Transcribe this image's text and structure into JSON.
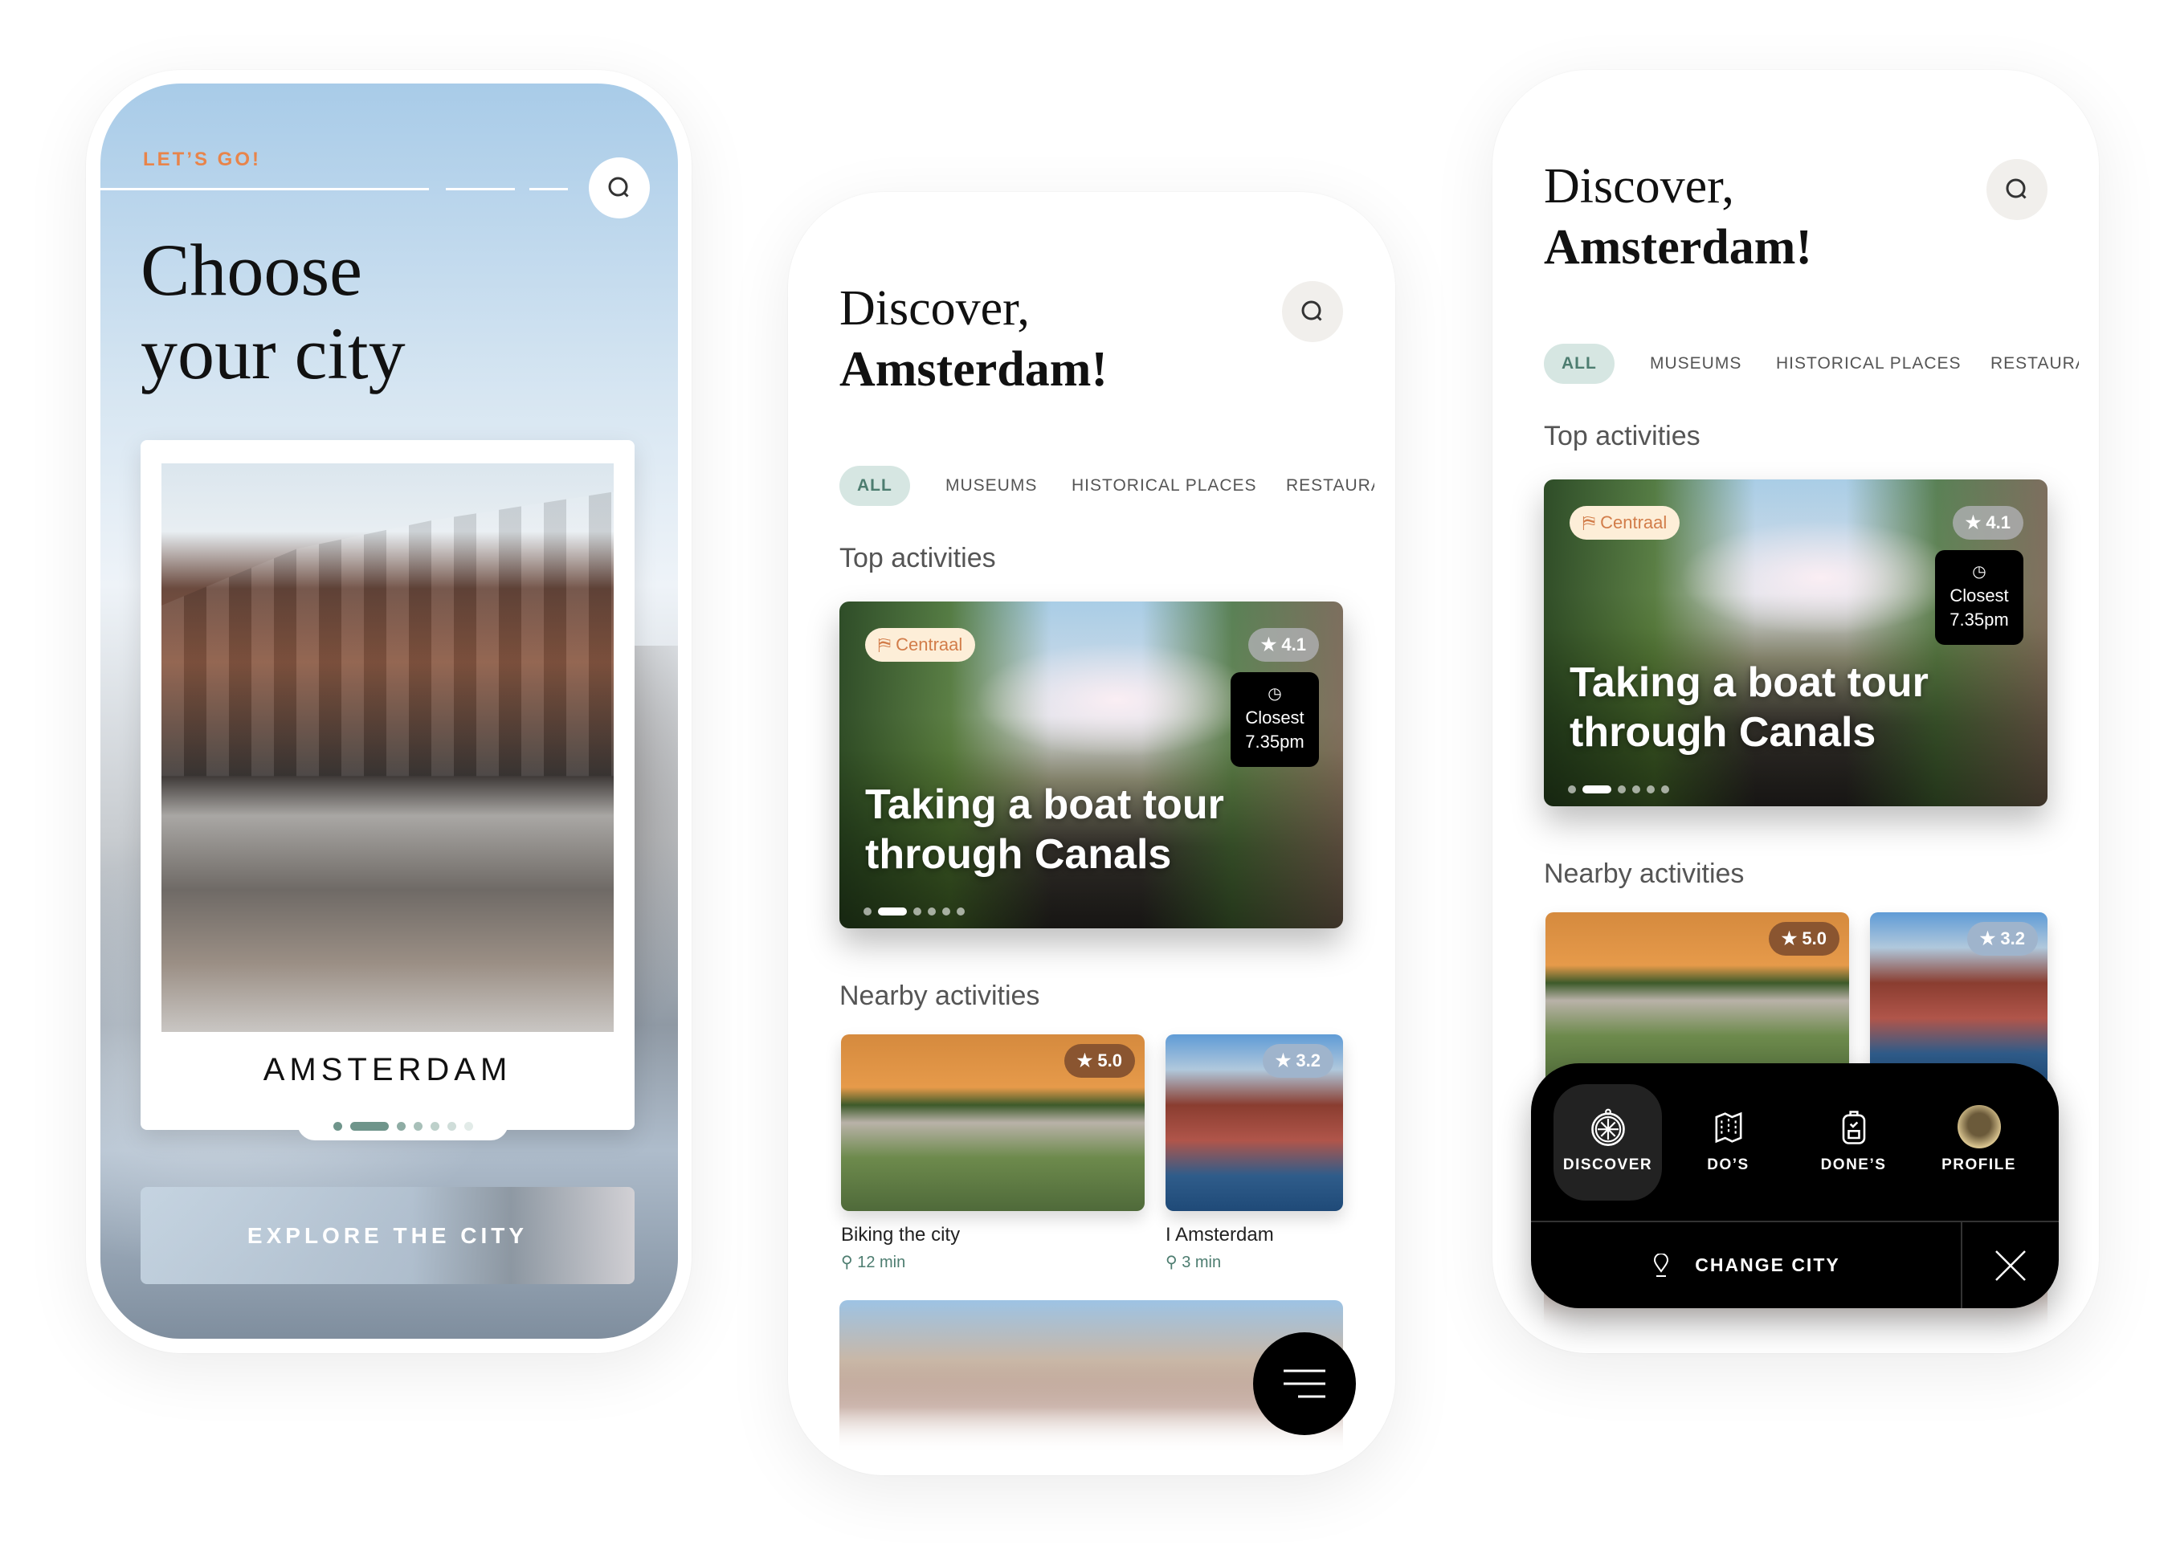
{
  "choose_screen": {
    "eyebrow": "LET’S GO!",
    "title_line1": "Choose",
    "title_line2": "your city",
    "city_name": "AMSTERDAM",
    "carousel": {
      "count": 7,
      "active": 1
    },
    "cta": "EXPLORE THE CITY",
    "search_icon": "search-icon"
  },
  "discover": {
    "greeting": "Discover,",
    "city": "Amsterdam!",
    "filters": [
      "ALL",
      "MUSEUMS",
      "HISTORICAL PLACES",
      "RESTAURAI"
    ],
    "active_filter": "ALL",
    "top_title": "Top activities",
    "top_card": {
      "tag": "Centraal",
      "rating": "★ 4.1",
      "closest_label": "Closest",
      "closest_time": "7.35pm",
      "title": "Taking a boat tour through Canals",
      "carousel": {
        "count": 7,
        "active": 1
      }
    },
    "nearby_title": "Nearby activities",
    "nearby": [
      {
        "name": "Biking the city",
        "time": "12 min",
        "rating": "★ 5.0",
        "rating_color": "#8a5530"
      },
      {
        "name": "I Amsterdam",
        "time": "3 min",
        "rating": "★ 3.2",
        "rating_color": "#9fb4cc"
      }
    ]
  },
  "nav_menu": {
    "items": [
      {
        "label": "DISCOVER",
        "icon": "compass-icon",
        "active": true
      },
      {
        "label": "DO’S",
        "icon": "map-icon"
      },
      {
        "label": "DONE’S",
        "icon": "backpack-icon"
      },
      {
        "label": "PROFILE",
        "icon": "avatar"
      }
    ],
    "change_city": "CHANGE CITY",
    "close_icon": "close-icon"
  },
  "colors": {
    "accent_orange": "#e8844a",
    "accent_green": "#4d7d70",
    "chip_bg": "#d6e6e2",
    "tag_bg": "#fdeed8"
  }
}
